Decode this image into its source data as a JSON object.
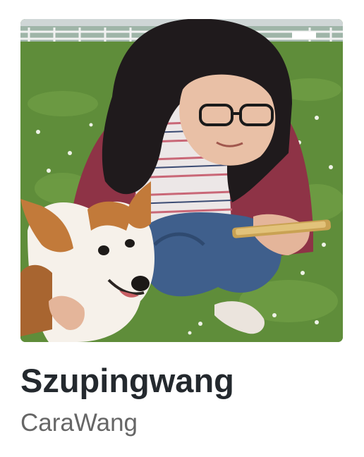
{
  "profile": {
    "display_name": "Szupingwang",
    "username": "CaraWang",
    "avatar": {
      "icon": "profile-photo",
      "colors": {
        "grass": "#5f8d3a",
        "sweater": "#8e3346",
        "jeans": "#3f5f8c",
        "hair": "#1f1a1c",
        "corgi_fur": "#c27a3a"
      }
    }
  }
}
